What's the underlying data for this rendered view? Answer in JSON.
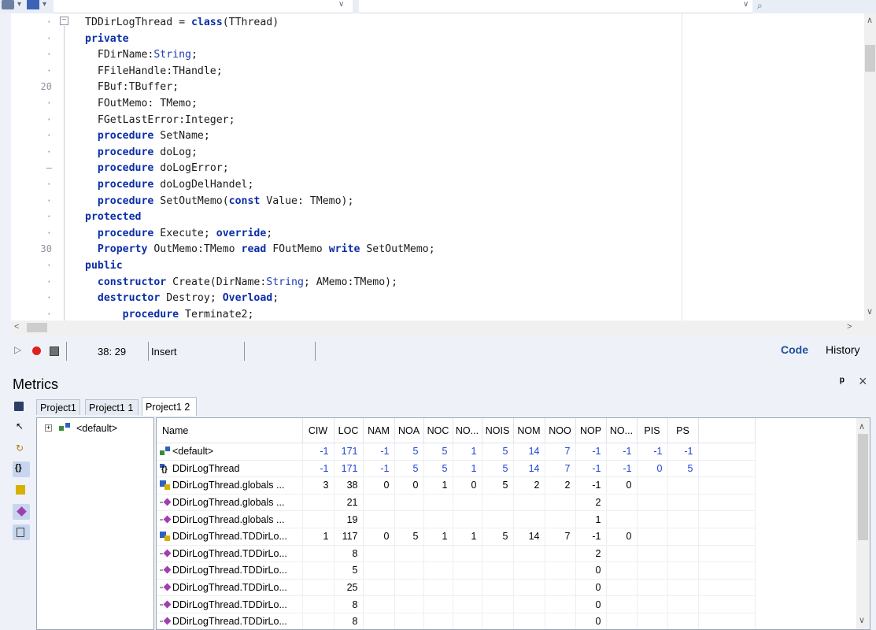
{
  "editor": {
    "gutter": [
      {
        "row": 0,
        "label": "·"
      },
      {
        "row": 1,
        "label": "·"
      },
      {
        "row": 2,
        "label": "·"
      },
      {
        "row": 3,
        "label": "·"
      },
      {
        "row": 4,
        "label": "20"
      },
      {
        "row": 5,
        "label": "·"
      },
      {
        "row": 6,
        "label": "·"
      },
      {
        "row": 7,
        "label": "·"
      },
      {
        "row": 8,
        "label": "·"
      },
      {
        "row": 9,
        "label": "–"
      },
      {
        "row": 10,
        "label": "·"
      },
      {
        "row": 11,
        "label": "·"
      },
      {
        "row": 12,
        "label": "·"
      },
      {
        "row": 13,
        "label": "·"
      },
      {
        "row": 14,
        "label": "30"
      },
      {
        "row": 15,
        "label": "·"
      },
      {
        "row": 16,
        "label": "·"
      },
      {
        "row": 17,
        "label": "·"
      },
      {
        "row": 18,
        "label": "·"
      }
    ],
    "lines": [
      [
        {
          "t": "TDDirLogThread = "
        },
        {
          "t": "class",
          "k": "kw"
        },
        {
          "t": "(TThread)"
        }
      ],
      [
        {
          "t": "private",
          "k": "kw"
        }
      ],
      [
        {
          "t": "  FDirName:"
        },
        {
          "t": "String",
          "k": "ty"
        },
        {
          "t": ";"
        }
      ],
      [
        {
          "t": "  FFileHandle:THandle;"
        }
      ],
      [
        {
          "t": "  FBuf:TBuffer;"
        }
      ],
      [
        {
          "t": "  FOutMemo: TMemo;"
        }
      ],
      [
        {
          "t": "  FGetLastError:Integer;"
        }
      ],
      [
        {
          "t": "  "
        },
        {
          "t": "procedure",
          "k": "kw"
        },
        {
          "t": " SetName;"
        }
      ],
      [
        {
          "t": "  "
        },
        {
          "t": "procedure",
          "k": "kw"
        },
        {
          "t": " doLog;"
        }
      ],
      [
        {
          "t": "  "
        },
        {
          "t": "procedure",
          "k": "kw"
        },
        {
          "t": " doLogError;"
        }
      ],
      [
        {
          "t": "  "
        },
        {
          "t": "procedure",
          "k": "kw"
        },
        {
          "t": " doLogDelHandel;"
        }
      ],
      [
        {
          "t": "  "
        },
        {
          "t": "procedure",
          "k": "kw"
        },
        {
          "t": " SetOutMemo("
        },
        {
          "t": "const",
          "k": "kw"
        },
        {
          "t": " Value: TMemo);"
        }
      ],
      [
        {
          "t": "protected",
          "k": "kw"
        }
      ],
      [
        {
          "t": "  "
        },
        {
          "t": "procedure",
          "k": "kw"
        },
        {
          "t": " Execute; "
        },
        {
          "t": "override",
          "k": "kw"
        },
        {
          "t": ";"
        }
      ],
      [
        {
          "t": "  "
        },
        {
          "t": "Property",
          "k": "kw"
        },
        {
          "t": " OutMemo:TMemo "
        },
        {
          "t": "read",
          "k": "kw"
        },
        {
          "t": " FOutMemo "
        },
        {
          "t": "write",
          "k": "kw"
        },
        {
          "t": " SetOutMemo;"
        }
      ],
      [
        {
          "t": "public",
          "k": "kw"
        }
      ],
      [
        {
          "t": "  "
        },
        {
          "t": "constructor",
          "k": "kw"
        },
        {
          "t": " Create(DirName:"
        },
        {
          "t": "String",
          "k": "ty"
        },
        {
          "t": "; AMemo:TMemo);"
        }
      ],
      [
        {
          "t": "  "
        },
        {
          "t": "destructor",
          "k": "kw"
        },
        {
          "t": " Destroy; "
        },
        {
          "t": "Overload",
          "k": "kw"
        },
        {
          "t": ";"
        }
      ],
      [
        {
          "t": "      "
        },
        {
          "t": "procedure",
          "k": "kw"
        },
        {
          "t": " Terminate2;"
        }
      ]
    ]
  },
  "status": {
    "position": "38: 29",
    "mode": "Insert",
    "tab_code": "Code",
    "tab_history": "History"
  },
  "metrics": {
    "title": "Metrics",
    "pin_glyph": "ᵖ",
    "close_glyph": "×",
    "tabs": [
      "Project1",
      "Project1 1",
      "Project1 2"
    ],
    "tree_root": "<default>",
    "columns": [
      "Name",
      "CIW",
      "LOC",
      "NAM",
      "NOA",
      "NOC",
      "NO...",
      "NOIS",
      "NOM",
      "NOO",
      "NOP",
      "NO...",
      "PIS",
      "PS"
    ],
    "rows": [
      {
        "icon": "package",
        "blue": true,
        "cells": [
          "<default>",
          "-1",
          "171",
          "-1",
          "5",
          "5",
          "1",
          "5",
          "14",
          "7",
          "-1",
          "-1",
          "-1",
          "-1"
        ]
      },
      {
        "icon": "unit",
        "blue": true,
        "cells": [
          "DDirLogThread",
          "-1",
          "171",
          "-1",
          "5",
          "5",
          "1",
          "5",
          "14",
          "7",
          "-1",
          "-1",
          "0",
          "5"
        ]
      },
      {
        "icon": "class",
        "blue": false,
        "cells": [
          "DDirLogThread.globals ...",
          "3",
          "38",
          "0",
          "0",
          "1",
          "0",
          "5",
          "2",
          "2",
          "-1",
          "0",
          "",
          ""
        ]
      },
      {
        "icon": "method",
        "blue": false,
        "cells": [
          "DDirLogThread.globals ...",
          "",
          "21",
          "",
          "",
          "",
          "",
          "",
          "",
          "",
          "2",
          "",
          "",
          ""
        ]
      },
      {
        "icon": "method",
        "blue": false,
        "cells": [
          "DDirLogThread.globals ...",
          "",
          "19",
          "",
          "",
          "",
          "",
          "",
          "",
          "",
          "1",
          "",
          "",
          ""
        ]
      },
      {
        "icon": "class",
        "blue": false,
        "cells": [
          "DDirLogThread.TDDirLo...",
          "1",
          "117",
          "0",
          "5",
          "1",
          "1",
          "5",
          "14",
          "7",
          "-1",
          "0",
          "",
          ""
        ]
      },
      {
        "icon": "method",
        "blue": false,
        "cells": [
          "DDirLogThread.TDDirLo...",
          "",
          "8",
          "",
          "",
          "",
          "",
          "",
          "",
          "",
          "2",
          "",
          "",
          ""
        ]
      },
      {
        "icon": "method",
        "blue": false,
        "cells": [
          "DDirLogThread.TDDirLo...",
          "",
          "5",
          "",
          "",
          "",
          "",
          "",
          "",
          "",
          "0",
          "",
          "",
          ""
        ]
      },
      {
        "icon": "method",
        "blue": false,
        "cells": [
          "DDirLogThread.TDDirLo...",
          "",
          "25",
          "",
          "",
          "",
          "",
          "",
          "",
          "",
          "0",
          "",
          "",
          ""
        ]
      },
      {
        "icon": "method",
        "blue": false,
        "cells": [
          "DDirLogThread.TDDirLo...",
          "",
          "8",
          "",
          "",
          "",
          "",
          "",
          "",
          "",
          "0",
          "",
          "",
          ""
        ]
      },
      {
        "icon": "method",
        "blue": false,
        "cells": [
          "DDirLogThread.TDDirLo...",
          "",
          "8",
          "",
          "",
          "",
          "",
          "",
          "",
          "",
          "0",
          "",
          "",
          ""
        ]
      }
    ]
  },
  "colors": {
    "keyword": "#0b2ea8",
    "blue_value": "#1f44d8",
    "accent": "#1e4fa0"
  }
}
